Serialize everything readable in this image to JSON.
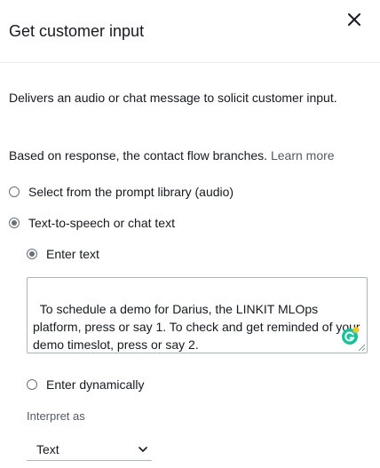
{
  "panel": {
    "title": "Get customer input",
    "description": "Delivers an audio or chat message to solicit customer input.",
    "branch_text": "Based on response, the contact flow branches.",
    "learn_more": "Learn more"
  },
  "options": {
    "prompt_library": {
      "label": "Select from the prompt library (audio)",
      "selected": false
    },
    "tts": {
      "label": "Text-to-speech or chat text",
      "selected": true
    },
    "enter_text": {
      "label": "Enter text",
      "selected": true
    },
    "enter_dynamically": {
      "label": "Enter dynamically",
      "selected": false
    }
  },
  "message_text": "To schedule a demo for Darius, the LINKIT MLOps platform, press or say 1. To check and get reminded of your demo timeslot, press or say 2.",
  "interpret": {
    "label": "Interpret as",
    "selected": "Text"
  },
  "icons": {
    "close": "close-icon",
    "grammarly": "grammarly-icon",
    "caret": "chevron-down-icon"
  },
  "colors": {
    "text": "#16191f",
    "muted": "#545b64",
    "border": "#aab7b8",
    "grammarly_green": "#15c39a",
    "grammarly_dot": "#f7c325"
  }
}
